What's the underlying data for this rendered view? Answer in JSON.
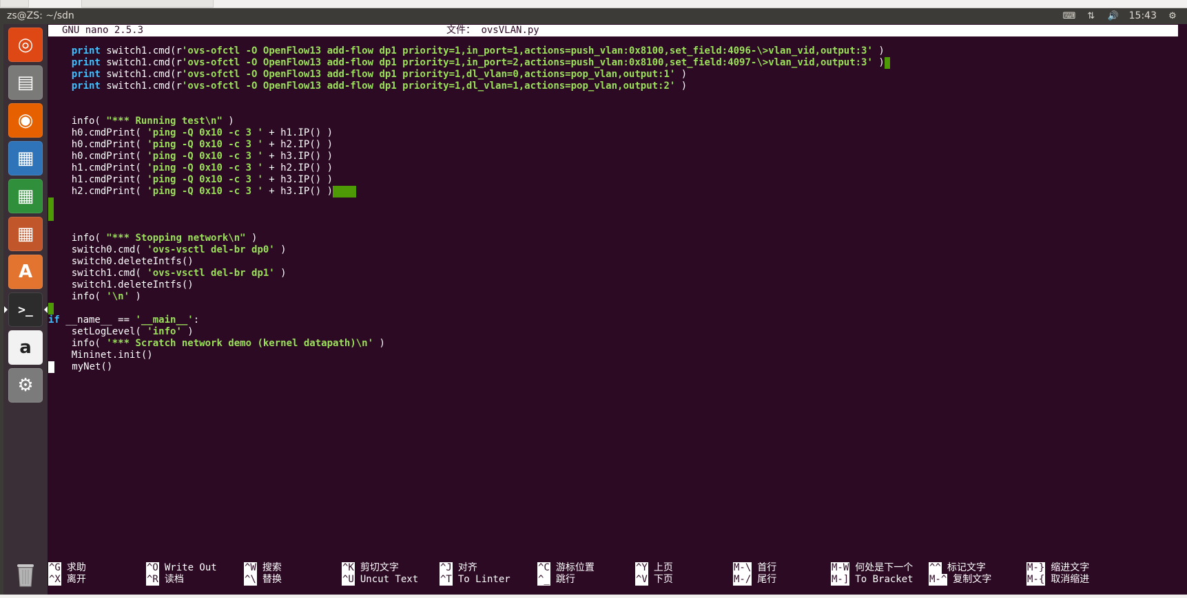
{
  "panel": {
    "window_title": "zs@ZS: ~/sdn",
    "clock": "15:43"
  },
  "launcher": {
    "items": [
      {
        "name": "ubuntu-dash-icon",
        "glyph": "◎",
        "bg": "#dd4814"
      },
      {
        "name": "files-icon",
        "glyph": "▤",
        "bg": "#7a7a78"
      },
      {
        "name": "firefox-icon",
        "glyph": "◉",
        "bg": "#e66000"
      },
      {
        "name": "writer-icon",
        "glyph": "▦",
        "bg": "#2f73b8"
      },
      {
        "name": "calc-icon",
        "glyph": "▦",
        "bg": "#2f8f3a"
      },
      {
        "name": "impress-icon",
        "glyph": "▦",
        "bg": "#c0562a"
      },
      {
        "name": "software-center-icon",
        "glyph": "A",
        "bg": "#e3742f"
      },
      {
        "name": "terminal-icon",
        "glyph": ">_",
        "bg": "#2c2c2c"
      },
      {
        "name": "amazon-icon",
        "glyph": "a",
        "bg": "#f2f2f2"
      },
      {
        "name": "system-settings-icon",
        "glyph": "⚙",
        "bg": "#7b7b7b"
      }
    ]
  },
  "nano": {
    "version": "GNU nano 2.5.3",
    "file_label": "文件：",
    "file_name": "ovsVLAN.py"
  },
  "code_lines": [
    {
      "segs": [
        {
          "t": "    ",
          "c": "plain"
        },
        {
          "t": "print",
          "c": "kw"
        },
        {
          "t": " switch1.cmd(r",
          "c": "plain"
        },
        {
          "t": "'ovs-ofctl -O OpenFlow13 add-flow dp1 priority=1,in_port=1,actions=push_vlan:0x8100,set_field:4096-\\>vlan_vid,output:3'",
          "c": "str"
        },
        {
          "t": " )",
          "c": "plain"
        }
      ]
    },
    {
      "segs": [
        {
          "t": "    ",
          "c": "plain"
        },
        {
          "t": "print",
          "c": "kw"
        },
        {
          "t": " switch1.cmd(r",
          "c": "plain"
        },
        {
          "t": "'ovs-ofctl -O OpenFlow13 add-flow dp1 priority=1,in_port=2,actions=push_vlan:0x8100,set_field:4097-\\>vlan_vid,output:3'",
          "c": "str"
        },
        {
          "t": " )",
          "c": "plain"
        },
        {
          "t": " ",
          "c": "ws"
        }
      ]
    },
    {
      "segs": [
        {
          "t": "    ",
          "c": "plain"
        },
        {
          "t": "print",
          "c": "kw"
        },
        {
          "t": " switch1.cmd(r",
          "c": "plain"
        },
        {
          "t": "'ovs-ofctl -O OpenFlow13 add-flow dp1 priority=1,dl_vlan=0,actions=pop_vlan,output:1'",
          "c": "str"
        },
        {
          "t": " )",
          "c": "plain"
        }
      ]
    },
    {
      "segs": [
        {
          "t": "    ",
          "c": "plain"
        },
        {
          "t": "print",
          "c": "kw"
        },
        {
          "t": " switch1.cmd(r",
          "c": "plain"
        },
        {
          "t": "'ovs-ofctl -O OpenFlow13 add-flow dp1 priority=1,dl_vlan=1,actions=pop_vlan,output:2'",
          "c": "str"
        },
        {
          "t": " )",
          "c": "plain"
        }
      ]
    },
    {
      "segs": []
    },
    {
      "segs": []
    },
    {
      "segs": [
        {
          "t": "    info( ",
          "c": "plain"
        },
        {
          "t": "\"*** Running test\\n\"",
          "c": "str"
        },
        {
          "t": " )",
          "c": "plain"
        }
      ]
    },
    {
      "segs": [
        {
          "t": "    h0.cmdPrint( ",
          "c": "plain"
        },
        {
          "t": "'ping -Q 0x10 -c 3 '",
          "c": "str"
        },
        {
          "t": " + h1.IP() )",
          "c": "plain"
        }
      ]
    },
    {
      "segs": [
        {
          "t": "    h0.cmdPrint( ",
          "c": "plain"
        },
        {
          "t": "'ping -Q 0x10 -c 3 '",
          "c": "str"
        },
        {
          "t": " + h2.IP() )",
          "c": "plain"
        }
      ]
    },
    {
      "segs": [
        {
          "t": "    h0.cmdPrint( ",
          "c": "plain"
        },
        {
          "t": "'ping -Q 0x10 -c 3 '",
          "c": "str"
        },
        {
          "t": " + h3.IP() )",
          "c": "plain"
        }
      ]
    },
    {
      "segs": [
        {
          "t": "    h1.cmdPrint( ",
          "c": "plain"
        },
        {
          "t": "'ping -Q 0x10 -c 3 '",
          "c": "str"
        },
        {
          "t": " + h2.IP() )",
          "c": "plain"
        }
      ]
    },
    {
      "segs": [
        {
          "t": "    h1.cmdPrint( ",
          "c": "plain"
        },
        {
          "t": "'ping -Q 0x10 -c 3 '",
          "c": "str"
        },
        {
          "t": " + h3.IP() )",
          "c": "plain"
        }
      ]
    },
    {
      "segs": [
        {
          "t": "    h2.cmdPrint( ",
          "c": "plain"
        },
        {
          "t": "'ping -Q 0x10 -c 3 '",
          "c": "str"
        },
        {
          "t": " + h3.IP() )",
          "c": "plain"
        },
        {
          "t": "    ",
          "c": "ws"
        }
      ]
    },
    {
      "segs": [
        {
          "t": " ",
          "c": "ws"
        }
      ]
    },
    {
      "segs": [
        {
          "t": " ",
          "c": "ws"
        }
      ]
    },
    {
      "segs": []
    },
    {
      "segs": [
        {
          "t": "    info( ",
          "c": "plain"
        },
        {
          "t": "\"*** Stopping network\\n\"",
          "c": "str"
        },
        {
          "t": " )",
          "c": "plain"
        }
      ]
    },
    {
      "segs": [
        {
          "t": "    switch0.cmd( ",
          "c": "plain"
        },
        {
          "t": "'ovs-vsctl del-br dp0'",
          "c": "str"
        },
        {
          "t": " )",
          "c": "plain"
        }
      ]
    },
    {
      "segs": [
        {
          "t": "    switch0.deleteIntfs()",
          "c": "plain"
        }
      ]
    },
    {
      "segs": [
        {
          "t": "    switch1.cmd( ",
          "c": "plain"
        },
        {
          "t": "'ovs-vsctl del-br dp1'",
          "c": "str"
        },
        {
          "t": " )",
          "c": "plain"
        }
      ]
    },
    {
      "segs": [
        {
          "t": "    switch1.deleteIntfs()",
          "c": "plain"
        }
      ]
    },
    {
      "segs": [
        {
          "t": "    info( ",
          "c": "plain"
        },
        {
          "t": "'\\n'",
          "c": "str"
        },
        {
          "t": " )",
          "c": "plain"
        }
      ]
    },
    {
      "segs": [
        {
          "t": " ",
          "c": "ws"
        }
      ]
    },
    {
      "segs": [
        {
          "t": "if",
          "c": "kw"
        },
        {
          "t": " __name__ == ",
          "c": "plain"
        },
        {
          "t": "'__main__'",
          "c": "str"
        },
        {
          "t": ":",
          "c": "plain"
        }
      ]
    },
    {
      "segs": [
        {
          "t": "    setLogLevel( ",
          "c": "plain"
        },
        {
          "t": "'info'",
          "c": "str"
        },
        {
          "t": " )",
          "c": "plain"
        }
      ]
    },
    {
      "segs": [
        {
          "t": "    info( ",
          "c": "plain"
        },
        {
          "t": "'*** Scratch network demo (kernel datapath)\\n'",
          "c": "str"
        },
        {
          "t": " )",
          "c": "plain"
        }
      ]
    },
    {
      "segs": [
        {
          "t": "    Mininet.init()",
          "c": "plain"
        }
      ]
    },
    {
      "segs": [
        {
          "t": " ",
          "c": "cursor"
        },
        {
          "t": "   myNet()",
          "c": "plain"
        }
      ]
    }
  ],
  "shortcuts": [
    {
      "k1": "^G",
      "l1": "求助",
      "k2": "^X",
      "l2": "离开"
    },
    {
      "k1": "^O",
      "l1": "Write Out",
      "k2": "^R",
      "l2": "读档"
    },
    {
      "k1": "^W",
      "l1": "搜索",
      "k2": "^\\",
      "l2": "替换"
    },
    {
      "k1": "^K",
      "l1": "剪切文字",
      "k2": "^U",
      "l2": "Uncut Text"
    },
    {
      "k1": "^J",
      "l1": "对齐",
      "k2": "^T",
      "l2": "To Linter"
    },
    {
      "k1": "^C",
      "l1": "游标位置",
      "k2": "^_",
      "l2": "跳行"
    },
    {
      "k1": "^Y",
      "l1": "上页",
      "k2": "^V",
      "l2": "下页"
    },
    {
      "k1": "M-\\",
      "l1": "首行",
      "k2": "M-/",
      "l2": "尾行"
    },
    {
      "k1": "M-W",
      "l1": "何处是下一个",
      "k2": "M-]",
      "l2": "To Bracket"
    },
    {
      "k1": "^^",
      "l1": "标记文字",
      "k2": "M-^",
      "l2": "复制文字"
    },
    {
      "k1": "M-}",
      "l1": "缩进文字",
      "k2": "M-{",
      "l2": "取消缩进"
    }
  ]
}
